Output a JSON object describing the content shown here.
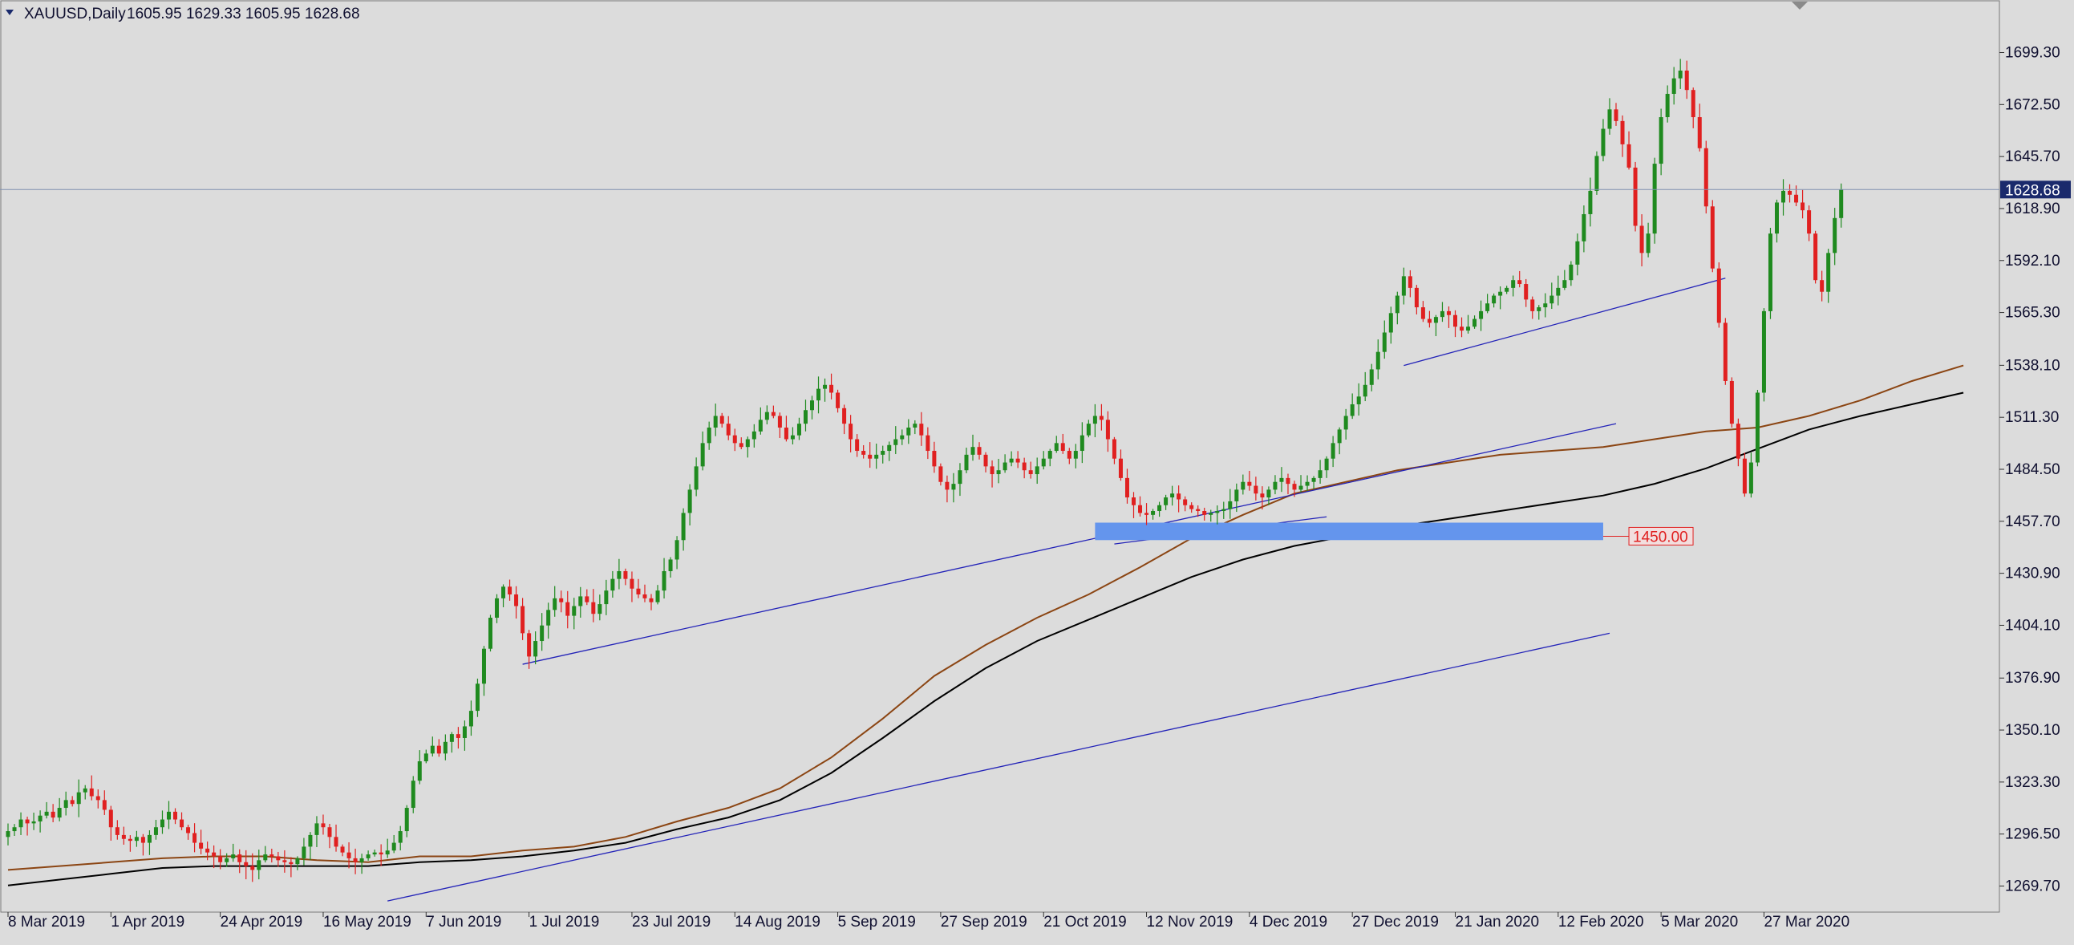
{
  "header": {
    "symbol_label": "XAUUSD,Daily",
    "ohlc_label": "1605.95 1629.33 1605.95 1628.68"
  },
  "colors": {
    "background": "#dcdcdc",
    "bull": "#1f8a1f",
    "bear": "#e02020",
    "ma_fast": "#8b4513",
    "ma_slow": "#000000",
    "trendline": "#2323b8",
    "support_zone": "#6495ed",
    "price_marker_bg": "#1a2a6c",
    "level_tag": "#e02020"
  },
  "price_marker": "1628.68",
  "level_tag": "1450.00",
  "chart_data": {
    "type": "candlestick",
    "y_axis": {
      "ticks": [
        "1699.30",
        "1672.50",
        "1645.70",
        "1618.90",
        "1592.10",
        "1565.30",
        "1538.10",
        "1511.30",
        "1484.50",
        "1457.70",
        "1430.90",
        "1404.10",
        "1376.90",
        "1350.10",
        "1323.30",
        "1296.50",
        "1269.70"
      ],
      "range": [
        1261.5,
        1711.5
      ]
    },
    "x_axis": {
      "ticks": [
        "8 Mar 2019",
        "1 Apr 2019",
        "24 Apr 2019",
        "16 May 2019",
        "7 Jun 2019",
        "1 Jul 2019",
        "23 Jul 2019",
        "14 Aug 2019",
        "5 Sep 2019",
        "27 Sep 2019",
        "21 Oct 2019",
        "12 Nov 2019",
        "4 Dec 2019",
        "27 Dec 2019",
        "21 Jan 2020",
        "12 Feb 2020",
        "5 Mar 2020",
        "27 Mar 2020"
      ],
      "tick_bars": [
        0,
        16,
        33,
        49,
        65,
        81,
        97,
        113,
        129,
        145,
        161,
        177,
        193,
        209,
        225,
        241,
        257,
        273
      ]
    },
    "closes": [
      1298,
      1300,
      1304,
      1302,
      1303,
      1306,
      1308,
      1305,
      1310,
      1314,
      1312,
      1318,
      1320,
      1316,
      1314,
      1309,
      1300,
      1296,
      1294,
      1293,
      1295,
      1292,
      1296,
      1300,
      1304,
      1308,
      1304,
      1300,
      1297,
      1292,
      1289,
      1287,
      1285,
      1282,
      1284,
      1286,
      1282,
      1280,
      1278,
      1283,
      1286,
      1285,
      1283,
      1282,
      1281,
      1284,
      1290,
      1296,
      1302,
      1300,
      1295,
      1290,
      1287,
      1284,
      1282,
      1284,
      1286,
      1287,
      1286,
      1288,
      1292,
      1298,
      1310,
      1324,
      1334,
      1338,
      1342,
      1338,
      1344,
      1348,
      1346,
      1352,
      1360,
      1374,
      1392,
      1408,
      1418,
      1424,
      1420,
      1414,
      1400,
      1388,
      1396,
      1404,
      1412,
      1418,
      1416,
      1409,
      1414,
      1419,
      1416,
      1410,
      1415,
      1422,
      1428,
      1432,
      1428,
      1423,
      1420,
      1418,
      1416,
      1422,
      1432,
      1438,
      1448,
      1462,
      1474,
      1486,
      1498,
      1506,
      1512,
      1508,
      1502,
      1498,
      1496,
      1500,
      1504,
      1510,
      1514,
      1512,
      1506,
      1500,
      1502,
      1508,
      1515,
      1520,
      1526,
      1528,
      1524,
      1516,
      1508,
      1500,
      1494,
      1492,
      1490,
      1492,
      1494,
      1497,
      1500,
      1502,
      1506,
      1508,
      1502,
      1494,
      1486,
      1478,
      1474,
      1477,
      1484,
      1492,
      1496,
      1492,
      1486,
      1482,
      1484,
      1488,
      1490,
      1488,
      1484,
      1482,
      1486,
      1490,
      1494,
      1498,
      1494,
      1490,
      1494,
      1502,
      1508,
      1512,
      1510,
      1500,
      1490,
      1480,
      1470,
      1466,
      1462,
      1461,
      1463,
      1466,
      1470,
      1472,
      1469,
      1466,
      1464,
      1463,
      1461,
      1462,
      1463,
      1464,
      1468,
      1474,
      1478,
      1476,
      1472,
      1470,
      1474,
      1478,
      1480,
      1477,
      1474,
      1476,
      1478,
      1480,
      1484,
      1490,
      1498,
      1505,
      1512,
      1518,
      1522,
      1528,
      1536,
      1545,
      1555,
      1565,
      1574,
      1584,
      1578,
      1568,
      1562,
      1560,
      1563,
      1566,
      1564,
      1558,
      1556,
      1558,
      1562,
      1566,
      1570,
      1574,
      1576,
      1578,
      1582,
      1580,
      1572,
      1566,
      1568,
      1570,
      1574,
      1578,
      1582,
      1590,
      1602,
      1616,
      1628,
      1646,
      1660,
      1670,
      1664,
      1652,
      1640,
      1610,
      1596,
      1606,
      1642,
      1666,
      1678,
      1686,
      1690,
      1680,
      1666,
      1650,
      1620,
      1588,
      1560,
      1530,
      1508,
      1490,
      1472,
      1488,
      1524,
      1566,
      1606,
      1622,
      1628,
      1626,
      1622,
      1618,
      1606,
      1582,
      1576,
      1596,
      1614,
      1628.68
    ],
    "ma_fast": [
      1278,
      1280,
      1282,
      1284,
      1285,
      1285,
      1283,
      1282,
      1285,
      1285,
      1288,
      1290,
      1295,
      1303,
      1310,
      1320,
      1336,
      1356,
      1378,
      1394,
      1408,
      1420,
      1434,
      1449,
      1461,
      1472,
      1478,
      1484,
      1488,
      1492,
      1494,
      1496,
      1500,
      1504,
      1506,
      1512,
      1520,
      1530,
      1538
    ],
    "ma_slow": [
      1270,
      1273,
      1276,
      1279,
      1280,
      1280,
      1280,
      1280,
      1282,
      1283,
      1285,
      1288,
      1292,
      1299,
      1305,
      1314,
      1328,
      1346,
      1365,
      1382,
      1396,
      1407,
      1418,
      1429,
      1438,
      1445,
      1450,
      1455,
      1459,
      1463,
      1467,
      1471,
      1477,
      1485,
      1495,
      1505,
      1512,
      1518,
      1524
    ],
    "ma_step": 8,
    "trendlines": [
      {
        "from": [
          59,
          1262
        ],
        "to": [
          249,
          1400
        ]
      },
      {
        "from": [
          80,
          1384
        ],
        "to": [
          250,
          1508
        ]
      },
      {
        "from": [
          172,
          1446
        ],
        "to": [
          205,
          1460
        ]
      },
      {
        "from": [
          217,
          1538
        ],
        "to": [
          267,
          1583
        ]
      }
    ],
    "support_zone": {
      "from_bar": 169,
      "to_bar": 248,
      "low": 1448,
      "high": 1457
    },
    "annotation": {
      "text": "1450.00",
      "price": 1450,
      "bar": 252
    }
  }
}
